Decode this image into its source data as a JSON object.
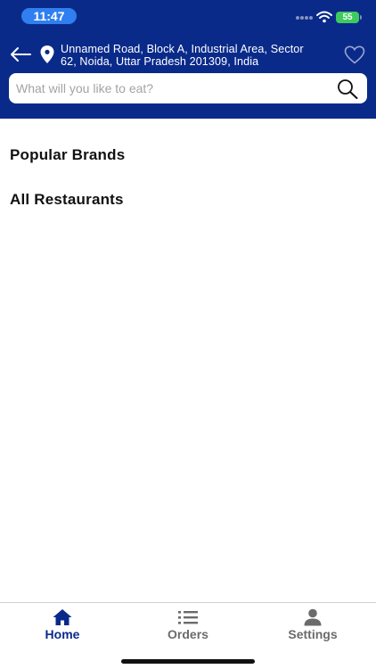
{
  "status_bar": {
    "time": "11:47",
    "battery": "55"
  },
  "header": {
    "address_line1": "Unnamed Road, Block A, Industrial Area, Sector",
    "address_line2": "62, Noida, Uttar Pradesh 201309, India"
  },
  "search": {
    "placeholder": "What will you like to eat?",
    "value": ""
  },
  "sections": {
    "popular_brands": "Popular Brands",
    "all_restaurants": "All Restaurants"
  },
  "tabs": [
    {
      "label": "Home",
      "icon": "home-icon",
      "active": true
    },
    {
      "label": "Orders",
      "icon": "list-icon",
      "active": false
    },
    {
      "label": "Settings",
      "icon": "person-icon",
      "active": false
    }
  ],
  "colors": {
    "header_bg": "#0a2a8a",
    "active_tab": "#0a2a8a",
    "inactive_tab": "#6b6b6b",
    "time_pill": "#2f7ff0",
    "battery": "#3ecb5e"
  }
}
